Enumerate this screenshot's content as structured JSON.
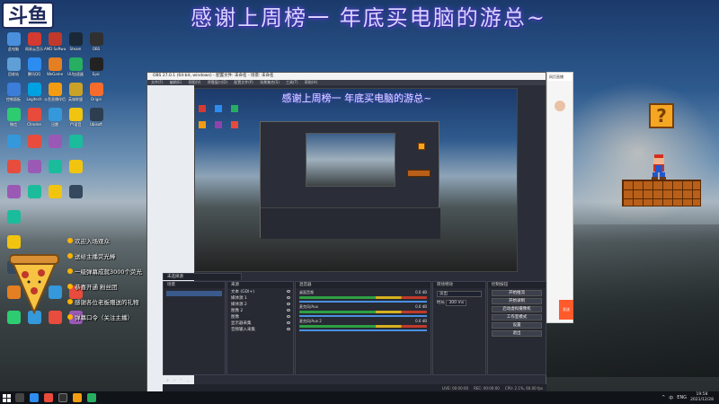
{
  "banner": {
    "text": "感谢上周榜一 年底买电脑的游总~",
    "logo": "斗鱼"
  },
  "desktop_icons": [
    {
      "label": "此电脑",
      "color": "#4a8fdc"
    },
    {
      "label": "网易云音乐",
      "color": "#d33a31"
    },
    {
      "label": "AMD Software",
      "color": "#c0392b"
    },
    {
      "label": "Steam",
      "color": "#1b2838"
    },
    {
      "label": "OBS",
      "color": "#303030"
    },
    {
      "label": "回收站",
      "color": "#5f9fd6"
    },
    {
      "label": "腾讯QQ",
      "color": "#2d8cf0"
    },
    {
      "label": "WeGame",
      "color": "#e67e22"
    },
    {
      "label": "UU加速器",
      "color": "#27ae60"
    },
    {
      "label": "Epic",
      "color": "#222"
    },
    {
      "label": "控制面板",
      "color": "#3b7dd8"
    },
    {
      "label": "Logitech",
      "color": "#00a1e0"
    },
    {
      "label": "斗鱼直播伴侣",
      "color": "#f39c12"
    },
    {
      "label": "英雄联盟",
      "color": "#c9a227"
    },
    {
      "label": "Origin",
      "color": "#f56c2d"
    },
    {
      "label": "微信",
      "color": "#2ecc71"
    },
    {
      "label": "Chrome",
      "color": "#e84b3c"
    },
    {
      "label": "迅雷",
      "color": "#3498db"
    },
    {
      "label": "YY语音",
      "color": "#f1c40f"
    },
    {
      "label": "Ubisoft",
      "color": "#2c3e50"
    }
  ],
  "obs": {
    "title": "OBS 27.0.1 (64-bit, windows) - 配置文件: 未命名 - 场景: 未命名",
    "menu": [
      "文件(F)",
      "编辑(E)",
      "视图(V)",
      "停靠窗口(D)",
      "配置文件(P)",
      "场景集合(S)",
      "工具(T)",
      "帮助(H)"
    ],
    "preview_banner": "感谢上周榜一 年底买电脑的游总~",
    "panels": {
      "scenes": "场景",
      "sources": "来源",
      "mixer": "混音器",
      "transitions": "转场特效",
      "controls": "控制按钮"
    },
    "source_label": "未选择源",
    "sources": [
      "文本 (GDI+)",
      "媒体源 1",
      "媒体源 2",
      "图像 2",
      "图像",
      "显示器采集",
      "音频输入采集"
    ],
    "mixer": [
      {
        "name": "桌面音频",
        "value": "0.0 dB"
      },
      {
        "name": "麦克风/Aux",
        "value": "0.0 dB"
      },
      {
        "name": "麦克风/Aux 2",
        "value": "0.0 dB"
      }
    ],
    "transition": {
      "type": "淡出",
      "duration_label": "时长",
      "duration": "300 ms"
    },
    "controls": [
      "开始推流",
      "开始录制",
      "启动虚拟摄像机",
      "工作室模式",
      "设置",
      "退出"
    ],
    "status": {
      "live": "LIVE: 00:00:00",
      "rec": "REC: 00:00:00",
      "cpu": "CPU: 2.1%, 60.00 fps"
    }
  },
  "overlay_chat": [
    "欢迎入场观众",
    "送给主播荧光棒",
    "一级弹幕成就3000个荧光",
    "恭喜开通 粉丝团",
    "感谢各位老板赠送的礼物",
    "弹幕口令（关注主播）"
  ],
  "chat_panel": {
    "header": "网页直播",
    "button": "发送"
  },
  "mario": {
    "qblock": "?"
  },
  "taskbar": {
    "tray": [
      "^",
      "中",
      "ENG"
    ],
    "time": "19:58",
    "date": "2021/12/28"
  }
}
